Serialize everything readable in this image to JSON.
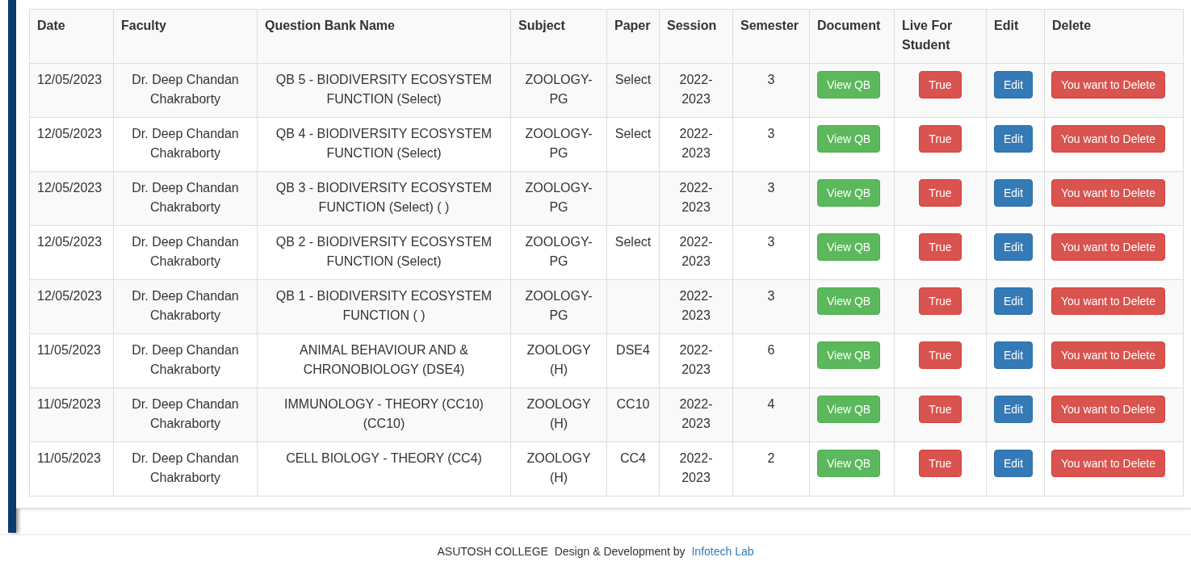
{
  "table": {
    "columns": [
      "Date",
      "Faculty",
      "Question Bank Name",
      "Subject",
      "Paper",
      "Session",
      "Semester",
      "Document",
      "Live For Student",
      "Edit",
      "Delete"
    ],
    "rows": [
      {
        "date": "12/05/2023",
        "faculty": "Dr. Deep Chandan Chakraborty",
        "name": "QB 5 - BIODIVERSITY ECOSYSTEM FUNCTION (Select)",
        "subject": "ZOOLOGY-PG",
        "paper": "Select",
        "session": "2022-2023",
        "semester": "3",
        "document": "View QB",
        "live": "True",
        "edit": "Edit",
        "delete": "You want to Delete"
      },
      {
        "date": "12/05/2023",
        "faculty": "Dr. Deep Chandan Chakraborty",
        "name": "QB 4 - BIODIVERSITY ECOSYSTEM FUNCTION (Select)",
        "subject": "ZOOLOGY-PG",
        "paper": "Select",
        "session": "2022-2023",
        "semester": "3",
        "document": "View QB",
        "live": "True",
        "edit": "Edit",
        "delete": "You want to Delete"
      },
      {
        "date": "12/05/2023",
        "faculty": "Dr. Deep Chandan Chakraborty",
        "name": "QB 3 - BIODIVERSITY ECOSYSTEM FUNCTION (Select) ( )",
        "subject": "ZOOLOGY-PG",
        "paper": "",
        "session": "2022-2023",
        "semester": "3",
        "document": "View QB",
        "live": "True",
        "edit": "Edit",
        "delete": "You want to Delete"
      },
      {
        "date": "12/05/2023",
        "faculty": "Dr. Deep Chandan Chakraborty",
        "name": "QB 2 - BIODIVERSITY ECOSYSTEM FUNCTION (Select)",
        "subject": "ZOOLOGY-PG",
        "paper": "Select",
        "session": "2022-2023",
        "semester": "3",
        "document": "View QB",
        "live": "True",
        "edit": "Edit",
        "delete": "You want to Delete"
      },
      {
        "date": "12/05/2023",
        "faculty": "Dr. Deep Chandan Chakraborty",
        "name": "QB 1 - BIODIVERSITY ECOSYSTEM FUNCTION ( )",
        "subject": "ZOOLOGY-PG",
        "paper": "",
        "session": "2022-2023",
        "semester": "3",
        "document": "View QB",
        "live": "True",
        "edit": "Edit",
        "delete": "You want to Delete"
      },
      {
        "date": "11/05/2023",
        "faculty": "Dr. Deep Chandan Chakraborty",
        "name": "ANIMAL BEHAVIOUR AND & CHRONOBIOLOGY (DSE4)",
        "subject": "ZOOLOGY (H)",
        "paper": "DSE4",
        "session": "2022-2023",
        "semester": "6",
        "document": "View QB",
        "live": "True",
        "edit": "Edit",
        "delete": "You want to Delete"
      },
      {
        "date": "11/05/2023",
        "faculty": "Dr. Deep Chandan Chakraborty",
        "name": "IMMUNOLOGY - THEORY (CC10) (CC10)",
        "subject": "ZOOLOGY (H)",
        "paper": "CC10",
        "session": "2022-2023",
        "semester": "4",
        "document": "View QB",
        "live": "True",
        "edit": "Edit",
        "delete": "You want to Delete"
      },
      {
        "date": "11/05/2023",
        "faculty": "Dr. Deep Chandan Chakraborty",
        "name": "CELL BIOLOGY - THEORY (CC4)",
        "subject": "ZOOLOGY (H)",
        "paper": "CC4",
        "session": "2022-2023",
        "semester": "2",
        "document": "View QB",
        "live": "True",
        "edit": "Edit",
        "delete": "You want to Delete"
      }
    ]
  },
  "footer": {
    "text": "ASUTOSH COLLEGE  Design & Development by",
    "link": "Infotech Lab"
  }
}
